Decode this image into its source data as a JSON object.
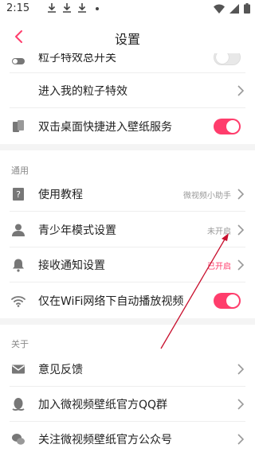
{
  "status_bar": {
    "time": "2:15"
  },
  "header": {
    "title": "设置"
  },
  "rows_top": [
    {
      "label": "粒子特效总开关",
      "toggle": "off"
    },
    {
      "label": "进入我的粒子特效"
    },
    {
      "label": "双击桌面快捷进入壁纸服务",
      "toggle": "on"
    }
  ],
  "section_general": {
    "title": "通用"
  },
  "rows_general": [
    {
      "label": "使用教程",
      "hint": "微视频小助手"
    },
    {
      "label": "青少年模式设置",
      "hint": "未开启"
    },
    {
      "label": "接收通知设置",
      "hint": "已开启"
    },
    {
      "label": "仅在WiFi网络下自动播放视频",
      "toggle": "on"
    }
  ],
  "section_about": {
    "title": "关于"
  },
  "rows_about": [
    {
      "label": "意见反馈"
    },
    {
      "label": "加入微视频壁纸官方QQ群"
    },
    {
      "label": "关注微视频壁纸官方公众号"
    }
  ],
  "colors": {
    "accent": "#ff3d6c",
    "annotation_arrow": "#c8102e"
  },
  "icons": {
    "statusbar": [
      "download-icon",
      "download-icon",
      "download-icon",
      "dot-icon",
      "wifi-icon",
      "signal-icon",
      "battery-icon"
    ],
    "rows": [
      "toggle-switch-icon",
      "phone-icon",
      "question-icon",
      "person-icon",
      "bell-icon",
      "wifi-icon",
      "mail-icon",
      "penguin-icon",
      "wechat-icon"
    ]
  }
}
